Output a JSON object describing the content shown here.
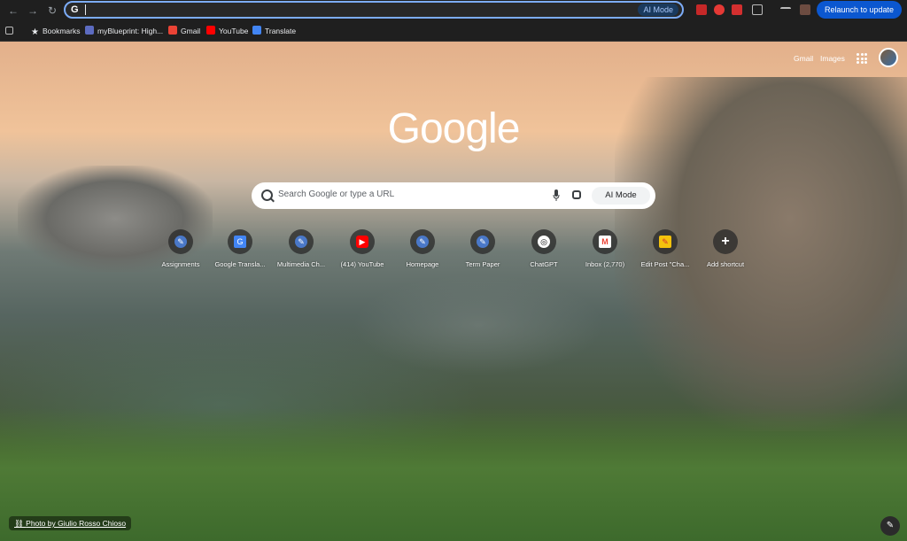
{
  "toolbar": {
    "omnibox_value": "",
    "ai_mode_label": "AI Mode",
    "relaunch_label": "Relaunch to update"
  },
  "bookmarks": {
    "items": [
      {
        "label": "Bookmarks",
        "icon": "star-icon"
      },
      {
        "label": "myBlueprint: High...",
        "icon": "myblueprint-icon"
      },
      {
        "label": "Gmail",
        "icon": "gmail-icon"
      },
      {
        "label": "YouTube",
        "icon": "youtube-icon"
      },
      {
        "label": "Translate",
        "icon": "translate-icon"
      }
    ]
  },
  "ntp": {
    "top_links": {
      "gmail": "Gmail",
      "images": "Images"
    },
    "logo_text": "Google",
    "search_placeholder": "Search Google or type a URL",
    "ai_mode_label": "AI Mode",
    "shortcuts": [
      {
        "label": "Assignments",
        "icon": "blueprint-icon"
      },
      {
        "label": "Google Transla...",
        "icon": "google-docs-icon"
      },
      {
        "label": "Multimedia Ch...",
        "icon": "blueprint-icon"
      },
      {
        "label": "(414) YouTube",
        "icon": "youtube-icon"
      },
      {
        "label": "Homepage",
        "icon": "blueprint-icon"
      },
      {
        "label": "Term Paper",
        "icon": "blueprint-icon"
      },
      {
        "label": "ChatGPT",
        "icon": "chatgpt-icon"
      },
      {
        "label": "Inbox (2,770)",
        "icon": "gmail-icon"
      },
      {
        "label": "Edit Post \"Cha...",
        "icon": "edit-post-icon"
      },
      {
        "label": "Add shortcut",
        "icon": "plus-icon"
      }
    ],
    "photo_credit": "Photo by Giulio Rosso Chioso"
  },
  "colors": {
    "accent": "#0b57d0",
    "omnibox_border": "#7cacf8"
  }
}
